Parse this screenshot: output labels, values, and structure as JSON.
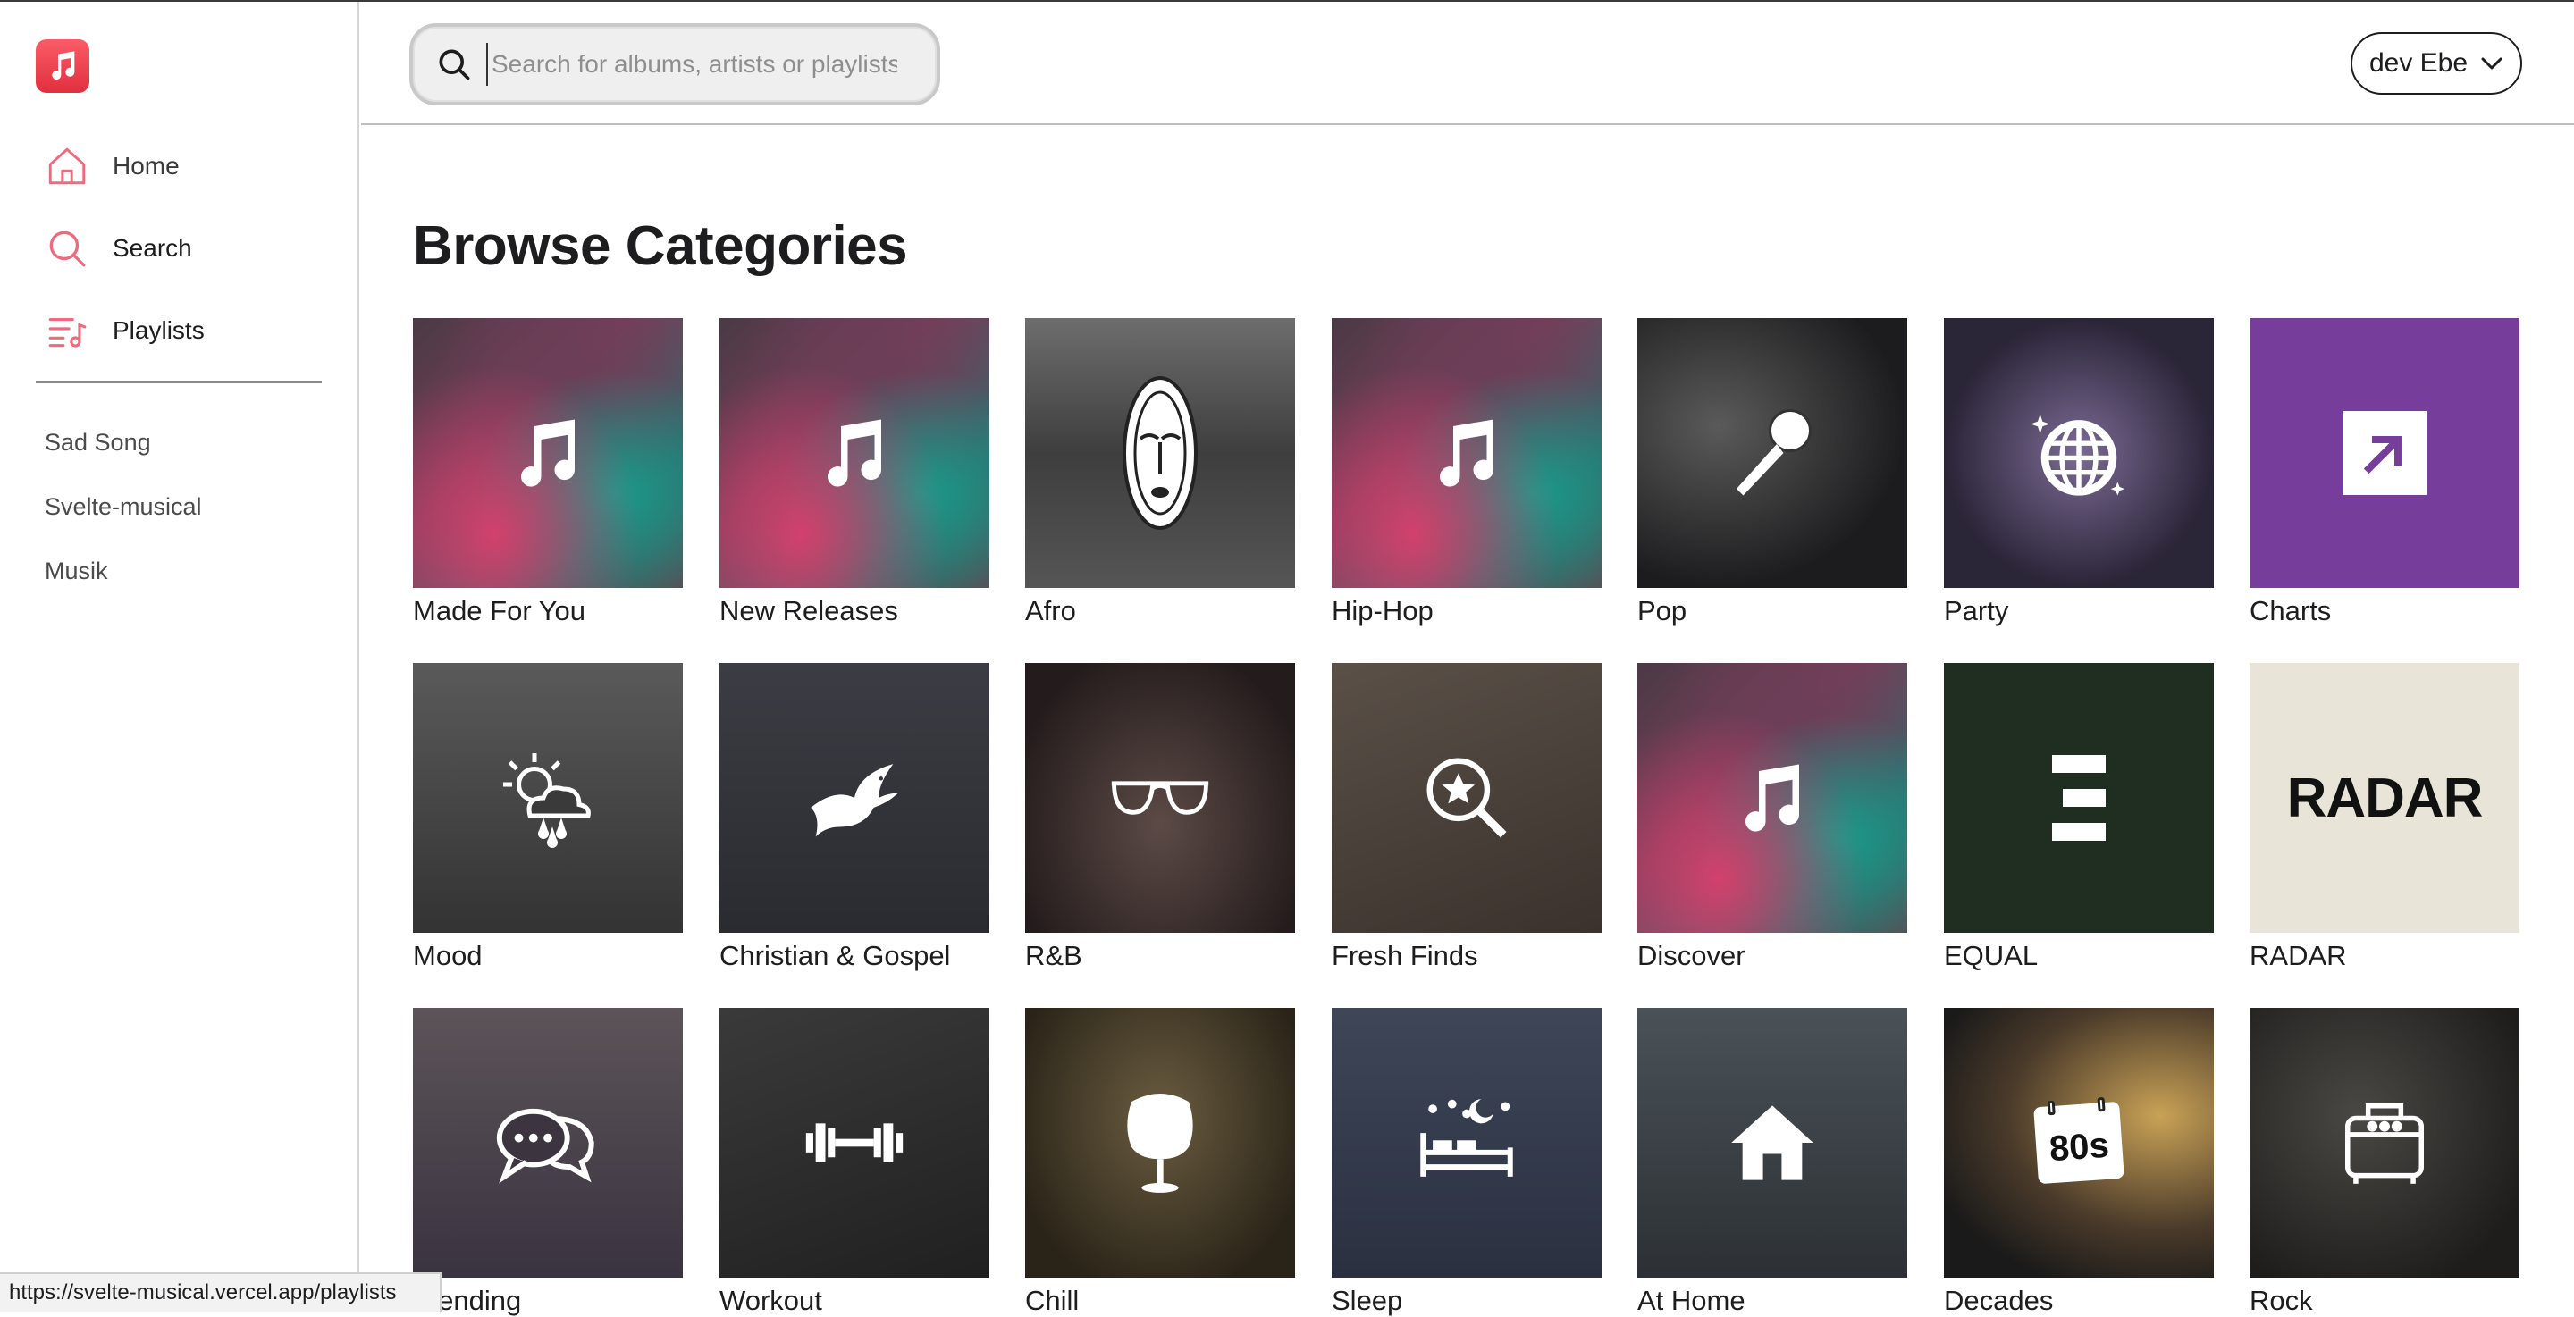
{
  "app": {
    "brand_color": "#e8364a"
  },
  "sidebar": {
    "logo_icon": "music-note-icon",
    "nav": [
      {
        "label": "Home",
        "icon": "home-icon"
      },
      {
        "label": "Search",
        "icon": "search-icon"
      },
      {
        "label": "Playlists",
        "icon": "playlist-icon"
      }
    ],
    "playlists": [
      "Sad Song",
      "Svelte-musical",
      "Musik"
    ]
  },
  "header": {
    "search": {
      "placeholder": "Search for albums, artists or playlists",
      "value": ""
    },
    "user": {
      "name": "dev Ebe",
      "icon": "chevron-down-icon"
    }
  },
  "main": {
    "title": "Browse Categories",
    "categories": [
      {
        "label": "Made For You",
        "icon": "music-note-icon"
      },
      {
        "label": "New Releases",
        "icon": "music-note-icon"
      },
      {
        "label": "Afro",
        "icon": "mask-icon"
      },
      {
        "label": "Hip-Hop",
        "icon": "music-note-icon"
      },
      {
        "label": "Pop",
        "icon": "microphone-icon"
      },
      {
        "label": "Party",
        "icon": "disco-ball-icon"
      },
      {
        "label": "Charts",
        "icon": "arrow-up-right-icon"
      },
      {
        "label": "Mood",
        "icon": "weather-icon"
      },
      {
        "label": "Christian & Gospel",
        "icon": "dove-icon"
      },
      {
        "label": "R&B",
        "icon": "sunglasses-icon"
      },
      {
        "label": "Fresh Finds",
        "icon": "star-search-icon"
      },
      {
        "label": "Discover",
        "icon": "music-note-icon"
      },
      {
        "label": "EQUAL",
        "icon": "equal-icon"
      },
      {
        "label": "RADAR",
        "icon": "radar-text-icon",
        "art_text": "RADAR"
      },
      {
        "label": "Trending",
        "icon": "chat-bubbles-icon"
      },
      {
        "label": "Workout",
        "icon": "dumbbell-icon"
      },
      {
        "label": "Chill",
        "icon": "egg-chair-icon"
      },
      {
        "label": "Sleep",
        "icon": "bed-icon"
      },
      {
        "label": "At Home",
        "icon": "house-icon"
      },
      {
        "label": "Decades",
        "icon": "calendar-80s-icon",
        "art_text": "80s"
      },
      {
        "label": "Rock",
        "icon": "amplifier-icon"
      }
    ]
  },
  "status_bar": {
    "url": "https://svelte-musical.vercel.app/playlists"
  }
}
